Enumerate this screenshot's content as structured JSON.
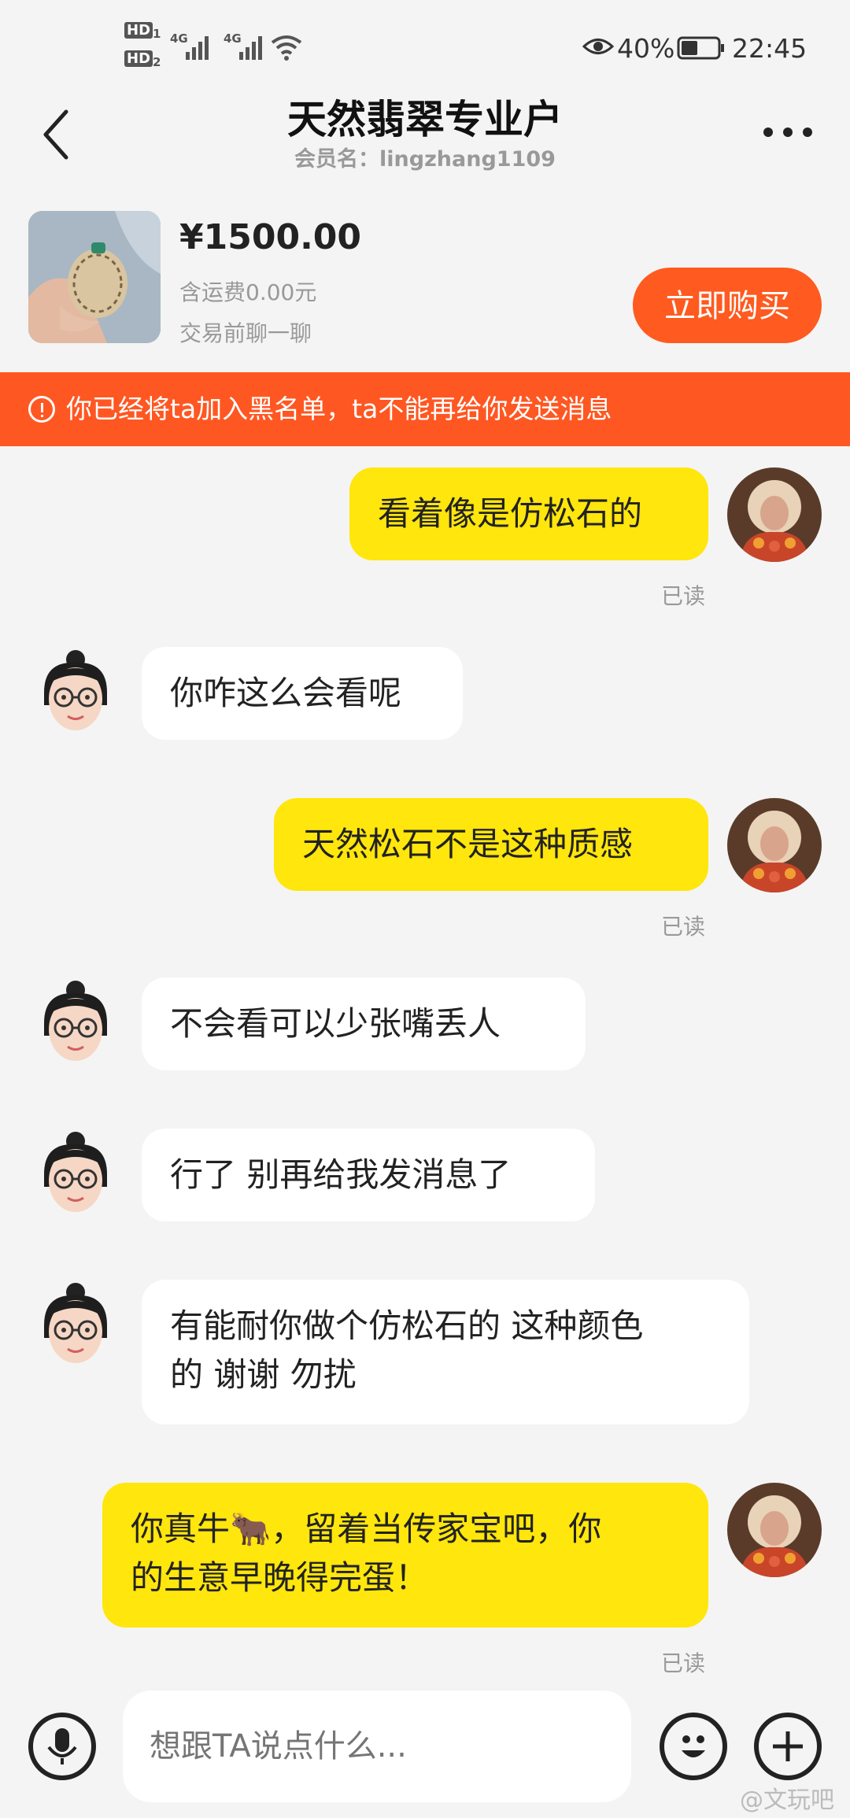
{
  "status_bar": {
    "hd1": "HD",
    "hd1_sub": "1",
    "hd2": "HD",
    "hd2_sub": "2",
    "net1": "4G",
    "net2": "4G",
    "battery": "40%",
    "time": "22:45",
    "icons": [
      "eye-icon",
      "battery-icon",
      "wifi-icon",
      "signal-icon"
    ]
  },
  "header": {
    "title": "天然翡翠专业户",
    "subtitle": "会员名：lingzhang1109"
  },
  "product": {
    "price": "¥1500.00",
    "shipping": "含运费0.00元",
    "note": "交易前聊一聊",
    "buy_label": "立即购买"
  },
  "banner": {
    "text": "你已经将ta加入黑名单，ta不能再给你发送消息"
  },
  "messages": [
    {
      "from": "me",
      "text": "看着像是仿松石的",
      "status": "已读"
    },
    {
      "from": "other",
      "text": "你咋这么会看呢"
    },
    {
      "from": "me",
      "text": "天然松石不是这种质感",
      "status": "已读"
    },
    {
      "from": "other",
      "text": "不会看可以少张嘴丢人"
    },
    {
      "from": "other",
      "text": "行了 别再给我发消息了"
    },
    {
      "from": "other",
      "lines": [
        "有能耐你做个仿松石的 这种颜色",
        "的 谢谢 勿扰"
      ]
    },
    {
      "from": "me",
      "lines": [
        "你真牛🐂，留着当传家宝吧，你",
        "的生意早晚得完蛋！"
      ],
      "status": "已读"
    }
  ],
  "input": {
    "placeholder": "想跟TA说点什么..."
  },
  "watermark": "@文玩吧",
  "colors": {
    "accent": "#ff5a1f",
    "banner": "#ff5722",
    "my_bubble": "#ffe60c"
  }
}
